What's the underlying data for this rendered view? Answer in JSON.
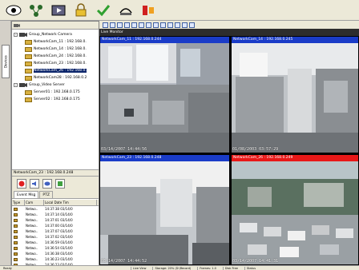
{
  "sidebar": {
    "tab_label": "Devices",
    "tree": [
      {
        "label": "Group_Network Camera",
        "level": 0,
        "type": "group"
      },
      {
        "label": "NetworkCam_11 : 192.168.0.",
        "level": 1,
        "type": "camera"
      },
      {
        "label": "NetworkCam_14 : 192.168.0.",
        "level": 1,
        "type": "camera"
      },
      {
        "label": "NetworkCam_24 : 192.168.0.",
        "level": 1,
        "type": "camera"
      },
      {
        "label": "NetworkCam_23 : 192.168.0.",
        "level": 1,
        "type": "camera"
      },
      {
        "label": "NetworkCam_26 : 192.168.0.",
        "level": 1,
        "type": "camera",
        "selected": true
      },
      {
        "label": "NetworkCam28 : 192.168.0.2",
        "level": 1,
        "type": "camera"
      },
      {
        "label": "Group_Video Server",
        "level": 0,
        "type": "group"
      },
      {
        "label": "Server01 : 192.168.0.175",
        "level": 1,
        "type": "camera"
      },
      {
        "label": "Server02 : 192.168.0.175",
        "level": 1,
        "type": "camera"
      }
    ],
    "preview_title": "NetworkCam_23 : 192.168.0.248",
    "tabs": [
      "Event Msg",
      "PTZ"
    ],
    "events": {
      "headers": [
        "Type",
        "Cam",
        "Local Date Tim"
      ],
      "rows": [
        {
          "cam": "Netwo..",
          "time": "14:37:38 03/14/0"
        },
        {
          "cam": "Netwo..",
          "time": "14:37:14 03/14/0"
        },
        {
          "cam": "Netwo..",
          "time": "14:37:01 03/14/0"
        },
        {
          "cam": "Netwo..",
          "time": "14:37:00 03/14/0"
        },
        {
          "cam": "Netwo..",
          "time": "14:37:07 03/14/0"
        },
        {
          "cam": "Netwo..",
          "time": "14:37:02 03/14/0"
        },
        {
          "cam": "Netwo..",
          "time": "14:36:59 03/14/0"
        },
        {
          "cam": "Netwo..",
          "time": "14:36:54 03/14/0"
        },
        {
          "cam": "Netwo..",
          "time": "14:36:38 03/14/0"
        },
        {
          "cam": "Netwo..",
          "time": "14:36:23 03/14/0"
        },
        {
          "cam": "Netwo..",
          "time": "14:36:23 03/14/0"
        },
        {
          "cam": "Netwo..",
          "time": "14:36:22 03/14/0"
        }
      ]
    }
  },
  "main": {
    "title": "Live Monitor",
    "cells": [
      {
        "title": "NetworkCam_11 : 192.168.0.244",
        "time": "03/14/2007 14:44:56",
        "alert": false
      },
      {
        "title": "NetworkCam_14 : 192.168.0.245",
        "time": "01/08/2003 03:57:29",
        "alert": false
      },
      {
        "title": "NetworkCam_23 : 192.168.0.248",
        "time": "03/14/2007 14:44:52",
        "alert": false
      },
      {
        "title": "NetworkCam_26 : 192.168.0.249",
        "time": "03/14/2007 14:41:31",
        "alert": true
      }
    ]
  },
  "status": {
    "left": "Ready",
    "segments": [
      "Live View",
      "Storage: 20% (D:\\Record)",
      "Frames: 1.0",
      "Disk Free",
      "Status"
    ]
  },
  "colors": {
    "title_blue": "#1a3cc8",
    "alert_red": "#e81818",
    "selection": "#0a246a"
  }
}
